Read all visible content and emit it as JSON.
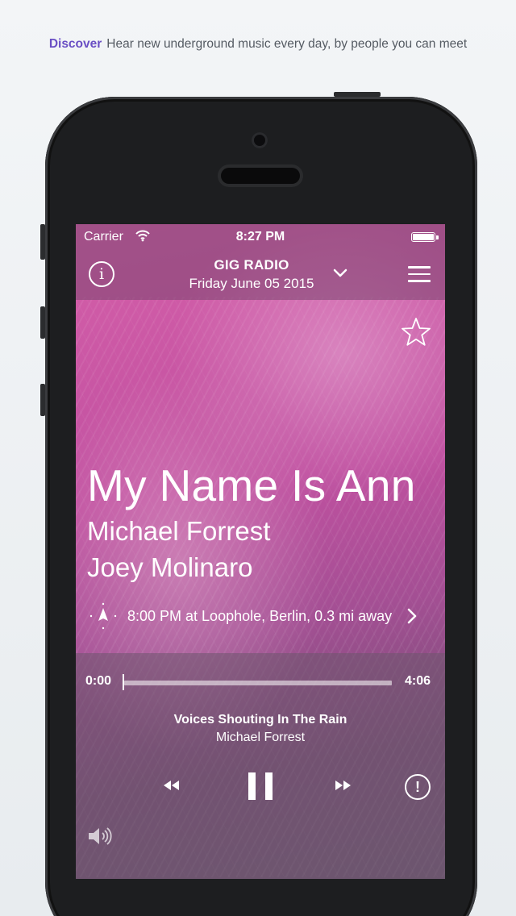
{
  "tagline": {
    "accent": "Discover",
    "text": "Hear new underground music every day, by people you can meet"
  },
  "statusbar": {
    "carrier": "Carrier",
    "time": "8:27 PM"
  },
  "navbar": {
    "title": "GIG RADIO",
    "date": "Friday June 05 2015",
    "info_label": "i"
  },
  "song": {
    "title": "My Name Is Ann",
    "artists": [
      "Michael Forrest",
      "Joey Molinaro"
    ],
    "event": "8:00 PM at Loophole, Berlin, 0.3 mi away"
  },
  "player": {
    "elapsed": "0:00",
    "duration": "4:06",
    "progress": 0,
    "track_name": "Voices Shouting In The Rain",
    "track_artist": "Michael Forrest",
    "alert_label": "!"
  },
  "colors": {
    "accent": "#6a4fc4",
    "overlay_pink": "#c050a0",
    "player_bg": "#6e556e"
  },
  "icons": [
    "wifi-icon",
    "battery-icon",
    "info-icon",
    "chevron-down-icon",
    "menu-icon",
    "star-icon",
    "location-pin-icon",
    "chevron-right-icon",
    "rewind-icon",
    "pause-icon",
    "fast-forward-icon",
    "alert-icon",
    "volume-icon"
  ]
}
